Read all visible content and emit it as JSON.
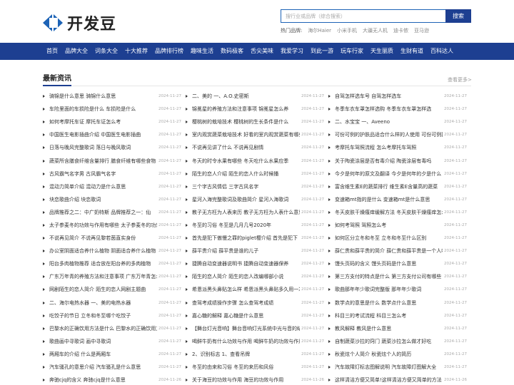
{
  "header": {
    "logo_text": "开发豆",
    "search_placeholder": "搜行业或品牌（综合搜索）",
    "search_button": "搜索",
    "hot_label": "热门品牌:",
    "hot_brands": [
      "海尔Haier",
      "小米手机",
      "大疆无人机",
      "迪卡侬",
      "亚马逊"
    ]
  },
  "nav": {
    "items": [
      "首页",
      "品牌大全",
      "词条大全",
      "十大推荐",
      "品牌排行榜",
      "趣味生活",
      "数码极客",
      "舌尖美味",
      "我爱学习",
      "到此一游",
      "玩车行家",
      "天生丽质",
      "生财有道",
      "百科达人"
    ]
  },
  "news": {
    "title": "最新资讯",
    "more": "查看更多>",
    "columns": [
      [
        {
          "t": "骑锦是什么意思 骑锦什么意思",
          "d": "2024-11-27"
        },
        {
          "t": "车险里面的车损险是什么 车损险是什么",
          "d": "2024-11-27"
        },
        {
          "t": "如何考摩托车证 摩托车证怎么考",
          "d": "2024-11-27"
        },
        {
          "t": "中国医生电影插曲介绍 中国医生电影插曲",
          "d": "2024-11-27"
        },
        {
          "t": "日落与晚风完整歌词 落日与晚风歌词",
          "d": "2024-11-27"
        },
        {
          "t": "蔬菜所含膳食纤维含量排行 膳食纤维有哪些食物",
          "d": "2024-11-27"
        },
        {
          "t": "古风霸气名字男 古风霸气名字",
          "d": "2024-11-27"
        },
        {
          "t": "混动力简单介绍 混动力是什么意思",
          "d": "2024-11-27"
        },
        {
          "t": "块恋歌曲介绍 块恋歌词",
          "d": "2024-11-27"
        },
        {
          "t": "品牌推荐之二：中广奶特斯 品牌推荐之一：仙",
          "d": "2024-11-27"
        },
        {
          "t": "太子参麦冬的功效与作用有哪些 太子参麦冬的功效",
          "d": "2024-11-27"
        },
        {
          "t": "不说再见简介 不说再见黎若茵直实身份",
          "d": "2024-11-27"
        },
        {
          "t": "办公室阴面适合养什么植物 阴面适合养什么植物",
          "d": "2024-11-27"
        },
        {
          "t": "阳台多肉植物推荐 适合放在阳台养的多肉植物",
          "d": "2024-11-27"
        },
        {
          "t": "广东万年青的养殖方法和注意事项 广东万年青怎么养",
          "d": "2024-11-27"
        },
        {
          "t": "网剧陌生的恋人简介 陌生的恋人网剧主题曲",
          "d": "2024-11-27"
        },
        {
          "t": "二、海尔电热水器 一、美的电热水器",
          "d": "2024-11-27"
        },
        {
          "t": "吃饺子的节日 立冬和冬至哪个吃饺子",
          "d": "2024-11-27"
        },
        {
          "t": "巴黎水的正确饮用方法是什么 巴黎水的正确饮用方法",
          "d": "2024-11-27"
        },
        {
          "t": "歌曲画中寻歌词 画中寻歌词",
          "d": "2024-11-27"
        },
        {
          "t": "两厢车的介绍 什么是两厢车",
          "d": "2024-11-27"
        },
        {
          "t": "汽车骚孔的意思介绍 汽车骚孔是什么意思",
          "d": "2024-11-27"
        },
        {
          "t": "奔驰cjq的含义 奔驰cjq是什么意思",
          "d": "2024-11-26"
        }
      ],
      [
        {
          "t": "二、美的 一、A.O.史密斯",
          "d": "2024-11-27"
        },
        {
          "t": "锦冕星的养殖方法和注意事项 锦冕星怎么养",
          "d": "2024-11-27"
        },
        {
          "t": "樱桃树的栽培技术 樱桃树的生长条件是什么",
          "d": "2024-11-27"
        },
        {
          "t": "室内观赏蔬菜栽培技术 好看的室内观赏蔬菜有哪些",
          "d": "2024-11-27"
        },
        {
          "t": "不说再见讲了什么 不说再见剧情",
          "d": "2024-11-27"
        },
        {
          "t": "冬天的时令水果有哪些 冬天吃什么水果应季",
          "d": "2024-11-27"
        },
        {
          "t": "陌生的恋人介绍 陌生的恋人什么时候播",
          "d": "2024-11-27"
        },
        {
          "t": "三个字古风情侣 三字古风名字",
          "d": "2024-11-27"
        },
        {
          "t": "星河入海完整歌词及歌曲简介 星河入海歌词",
          "d": "2024-11-27"
        },
        {
          "t": "教子无方枉为人表来历 教子无方枉为人表什么意思",
          "d": "2024-11-27"
        },
        {
          "t": "冬至的习俗 冬至是几月几号2020年",
          "d": "2024-11-27"
        },
        {
          "t": "首先是犯下傲慢之罪的piglet樱介绍 首先是犯下",
          "d": "2024-11-27"
        },
        {
          "t": "薛平贵介绍 薛平贵是谁的儿子",
          "d": "2024-11-27"
        },
        {
          "t": "捷腾自动变速器说明书 捷腾自动变速器保养",
          "d": "2024-11-27"
        },
        {
          "t": "陌生的恋人简介 陌生的恋人改编哪部小说",
          "d": "2024-11-27"
        },
        {
          "t": "希恩派黑头鼻贴怎么样 希恩派黑头鼻贴多久用一次",
          "d": "2024-11-27"
        },
        {
          "t": "查驾考成绩操作步骤 怎么查驾考成绩",
          "d": "2024-11-27"
        },
        {
          "t": "嘉心糖的解释 嘉心糖是什么意思",
          "d": "2024-11-27"
        },
        {
          "t": "【舞台灯光音响】舞台音响灯光系统中光与音的结合",
          "d": "2024-11-27"
        },
        {
          "t": "喝鲜牛奶有什么功效与作用 喝鲜牛奶的功效与作用",
          "d": "2024-11-27"
        },
        {
          "t": "2、识别标志 1、查看吊牌",
          "d": "2024-11-27"
        },
        {
          "t": "冬至的由来和习俗 冬至的来历和风俗",
          "d": "2024-11-27"
        },
        {
          "t": "关于海豆的功效与作用 海豆的功效与作用",
          "d": "2024-11-26"
        }
      ],
      [
        {
          "t": "自驾怎样选车号 自驾怎样选车",
          "d": "2024-11-27"
        },
        {
          "t": "冬季车衣车罩怎样选购 冬季车衣车罩怎样选",
          "d": "2024-11-27"
        },
        {
          "t": "二、水宝宝 一、Aveeno",
          "d": "2024-11-27"
        },
        {
          "t": "可份可例的护肤品适合什么样的人使用 可份可例护肤品",
          "d": "2024-11-27"
        },
        {
          "t": "考摩托车驾照流程 怎么考摩托车驾照",
          "d": "2024-11-27"
        },
        {
          "t": "关于陶瓷涂层是否有毒介绍 陶瓷涂层有毒吗",
          "d": "2024-11-27"
        },
        {
          "t": "今夕是何年的原文及翻译 今夕是何年的夕是什么",
          "d": "2024-11-27"
        },
        {
          "t": "富含维生素E的蔬菜排行 维生素E含量高的蔬菜",
          "d": "2024-11-27"
        },
        {
          "t": "变速箱mt指的是什么 变速箱mt是什么意思",
          "d": "2024-11-27"
        },
        {
          "t": "冬天皮肤干燥瘙痒缓解方法 冬天皮肤干燥瘙痒怎么办",
          "d": "2024-11-27"
        },
        {
          "t": "如何考驾照 驾照怎么考",
          "d": "2024-11-27"
        },
        {
          "t": "如何区分立冬和冬至 立冬和冬至什么区别",
          "d": "2024-11-27"
        },
        {
          "t": "薛仁贵和薛平贵的简介 薛仁贵和薛平贵是一个人吗",
          "d": "2024-11-27"
        },
        {
          "t": "馒头页码的含义 馒头页码是什么意思",
          "d": "2024-11-27"
        },
        {
          "t": "第三方支付的特点是什么 第三方支付公司有哪些",
          "d": "2024-11-27"
        },
        {
          "t": "歌曲那年年少歌词完整版 那年年少歌词",
          "d": "2024-11-27"
        },
        {
          "t": "数学点的意思是什么 数学点什么意思",
          "d": "2024-11-27"
        },
        {
          "t": "科目三的考试流程 科目三怎么考",
          "d": "2024-11-27"
        },
        {
          "t": "教风解释 教风是什么意思",
          "d": "2024-11-27"
        },
        {
          "t": "自制蔬菜沙拉的窍门 蔬菜沙拉怎么做才好吃",
          "d": "2024-11-27"
        },
        {
          "t": "秋瓷炫个人简介 秋瓷炫个人的简历",
          "d": "2024-11-27"
        },
        {
          "t": "汽车故障灯标志图解说明 汽车故障灯图解大全",
          "d": "2024-11-27"
        },
        {
          "t": "这样清洁方便又简单!这样清洁方便又简单的方法",
          "d": "2024-11-26"
        }
      ]
    ]
  },
  "colors": {
    "brand": "#1d3f91",
    "logo": "#1d63b6"
  },
  "icons": {
    "logo": "logo-mark-icon",
    "bullet": "arrow-right-icon"
  }
}
